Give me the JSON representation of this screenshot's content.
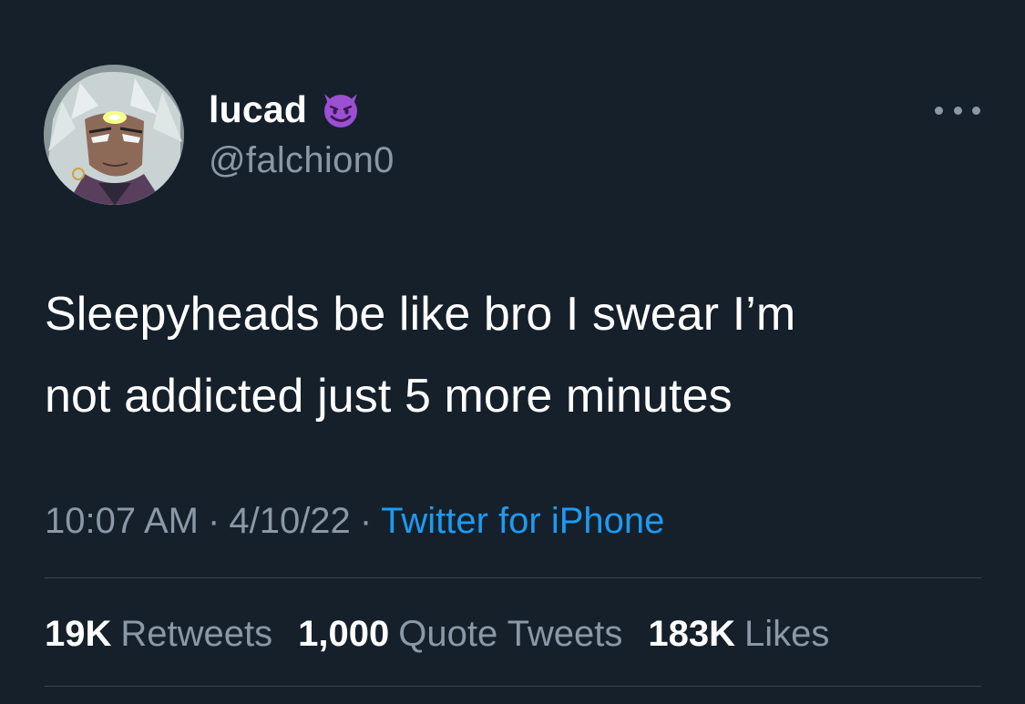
{
  "user": {
    "display_name": "lucad",
    "handle": "@falchion0",
    "badge_icon": "smiling-devil-emoji-icon",
    "avatar_icon": "anime-character-avatar"
  },
  "tweet": {
    "text_line1": "Sleepyheads be like bro I swear I’m",
    "text_line2": "not addicted just 5 more minutes",
    "time": "10:07 AM",
    "date": "4/10/22",
    "separator": "·",
    "source": "Twitter for iPhone"
  },
  "stats": {
    "retweets_count": "19K",
    "retweets_label": "Retweets",
    "quotes_count": "1,000",
    "quotes_label": "Quote Tweets",
    "likes_count": "183K",
    "likes_label": "Likes"
  },
  "colors": {
    "background": "#15202b",
    "primary_text": "#ffffff",
    "secondary_text": "#8b98a5",
    "link": "#1d9bf0",
    "divider": "#38444d",
    "emoji_purple": "#9b4fd1"
  }
}
